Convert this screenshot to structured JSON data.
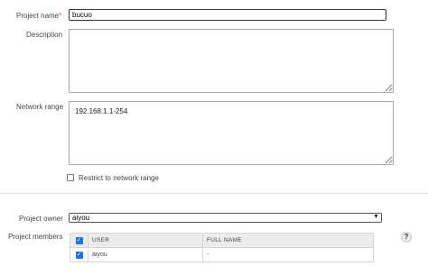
{
  "form": {
    "project_name_label": "Project name",
    "required_marker": "*",
    "project_name_value": "bucuo",
    "description_label": "Description",
    "description_value": "",
    "network_range_label": "Network range",
    "network_range_value": "192.168.1.1-254",
    "restrict_label": "Restrict to network range",
    "project_owner_label": "Project owner",
    "project_owner_value": "aiyou",
    "project_members_label": "Project members"
  },
  "members_table": {
    "headers": [
      "USER",
      "FULL NAME"
    ],
    "rows": [
      {
        "user": "aiyou",
        "full_name": "-"
      }
    ]
  },
  "icons": {
    "help": "?",
    "check": "✓",
    "dropdown": "▼"
  },
  "colors": {
    "accent": "#1a73e8"
  }
}
